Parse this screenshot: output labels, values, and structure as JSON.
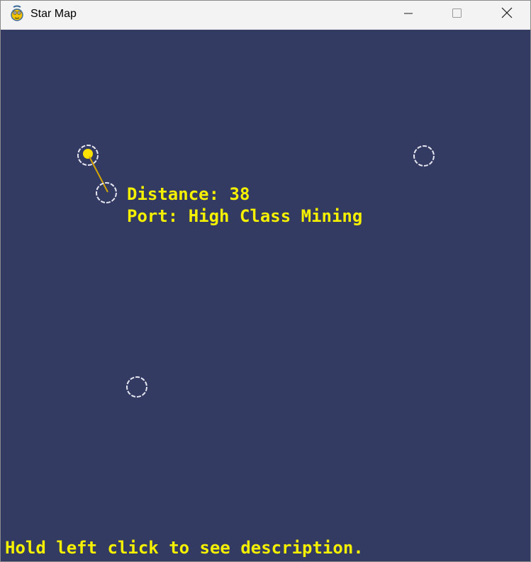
{
  "window": {
    "title": "Star Map",
    "icon": "pygame-snake-icon",
    "controls": [
      "minimize-icon",
      "maximize-icon",
      "close-icon"
    ]
  },
  "colors": {
    "background": "#333b63",
    "titlebar": "#f3f3f3",
    "text": "#f5f000",
    "star_ring": "#e6e6f0",
    "selected_star": "#ffe100",
    "route_line": "#d7a600"
  },
  "info_panel": {
    "distance_text": "Distance: 38",
    "port_text": "Port: High Class Mining"
  },
  "footer": {
    "hint": "Hold left click to see description."
  }
}
